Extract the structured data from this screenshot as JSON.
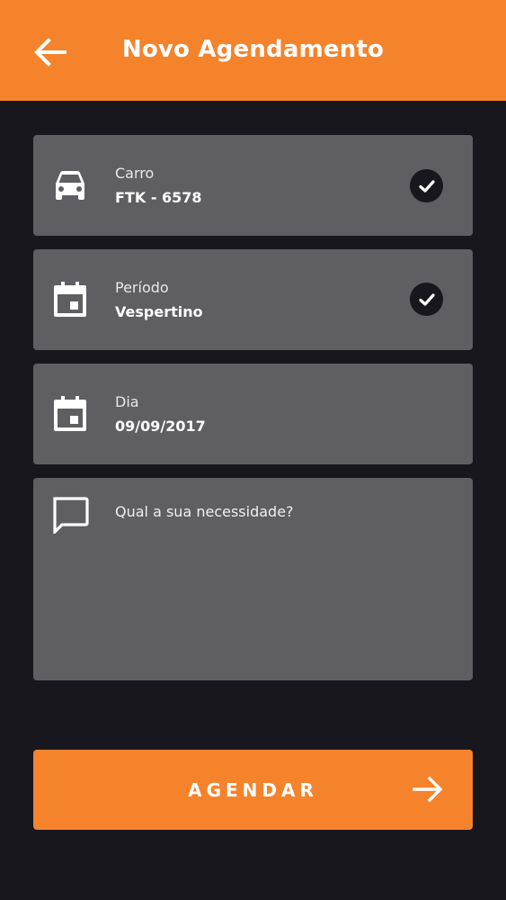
{
  "appbar": {
    "title": "Novo Agendamento",
    "back_icon": "arrow-left-icon",
    "color": "#f5832b"
  },
  "form": {
    "car": {
      "icon": "car-icon",
      "label": "Carro",
      "value": "FTK - 6578",
      "checked": true
    },
    "period": {
      "icon": "calendar-icon",
      "label": "Período",
      "value": "Vespertino",
      "checked": true
    },
    "day": {
      "icon": "calendar-icon",
      "label": "Dia",
      "value": "09/09/2017",
      "checked": false
    },
    "need": {
      "icon": "comment-icon",
      "placeholder": "Qual a sua necessidade?"
    }
  },
  "submit": {
    "label": "AGENDAR",
    "icon": "arrow-right-icon"
  },
  "colors": {
    "accent": "#f5832b",
    "background": "#17171d",
    "card": "#5e5e63"
  }
}
